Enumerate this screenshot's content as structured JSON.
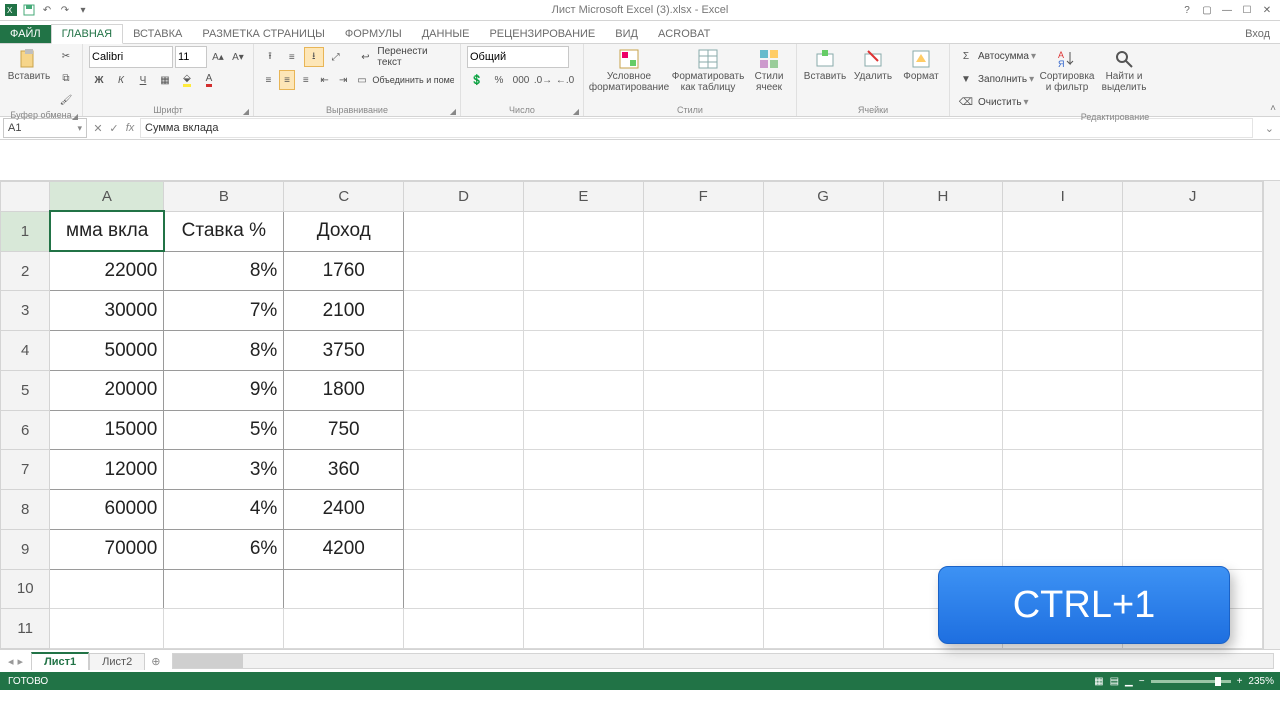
{
  "title": "Лист Microsoft Excel (3).xlsx - Excel",
  "ribbonTabs": {
    "file": "ФАЙЛ",
    "home": "ГЛАВНАЯ",
    "insert": "ВСТАВКА",
    "layout": "РАЗМЕТКА СТРАНИЦЫ",
    "formulas": "ФОРМУЛЫ",
    "data": "ДАННЫЕ",
    "review": "РЕЦЕНЗИРОВАНИЕ",
    "view": "ВИД",
    "acrobat": "ACROBAT",
    "signin": "Вход"
  },
  "ribbon": {
    "clipboard": {
      "paste": "Вставить",
      "label": "Буфер обмена"
    },
    "font": {
      "name": "Calibri",
      "size": "11",
      "label": "Шрифт",
      "bold": "Ж",
      "italic": "К",
      "underline": "Ч"
    },
    "alignment": {
      "wrap": "Перенести текст",
      "merge": "Объединить и поместить в центре",
      "label": "Выравнивание"
    },
    "number": {
      "format": "Общий",
      "label": "Число"
    },
    "styles": {
      "cond": "Условное форматирование",
      "table": "Форматировать как таблицу",
      "cell": "Стили ячеек",
      "label": "Стили"
    },
    "cells": {
      "insert": "Вставить",
      "delete": "Удалить",
      "format": "Формат",
      "label": "Ячейки"
    },
    "editing": {
      "autosum": "Автосумма",
      "fill": "Заполнить",
      "clear": "Очистить",
      "sort": "Сортировка и фильтр",
      "find": "Найти и выделить",
      "label": "Редактирование"
    }
  },
  "nameBox": "A1",
  "formulaBar": "Сумма вклада",
  "columns": [
    "A",
    "B",
    "C",
    "D",
    "E",
    "F",
    "G",
    "H",
    "I",
    "J"
  ],
  "rows": [
    "1",
    "2",
    "3",
    "4",
    "5",
    "6",
    "7",
    "8",
    "9",
    "10",
    "11"
  ],
  "cells": {
    "A1": "мма вкла",
    "B1": "Ставка %",
    "C1": "Доход",
    "A2": "22000",
    "B2": "8%",
    "C2": "1760",
    "A3": "30000",
    "B3": "7%",
    "C3": "2100",
    "A4": "50000",
    "B4": "8%",
    "C4": "3750",
    "A5": "20000",
    "B5": "9%",
    "C5": "1800",
    "A6": "15000",
    "B6": "5%",
    "C6": "750",
    "A7": "12000",
    "B7": "3%",
    "C7": "360",
    "A8": "60000",
    "B8": "4%",
    "C8": "2400",
    "A9": "70000",
    "B9": "6%",
    "C9": "4200"
  },
  "sheetTabs": {
    "s1": "Лист1",
    "s2": "Лист2",
    "add": "⊕"
  },
  "status": {
    "ready": "ГОТОВО",
    "zoom": "235%"
  },
  "hint": "CTRL+1"
}
